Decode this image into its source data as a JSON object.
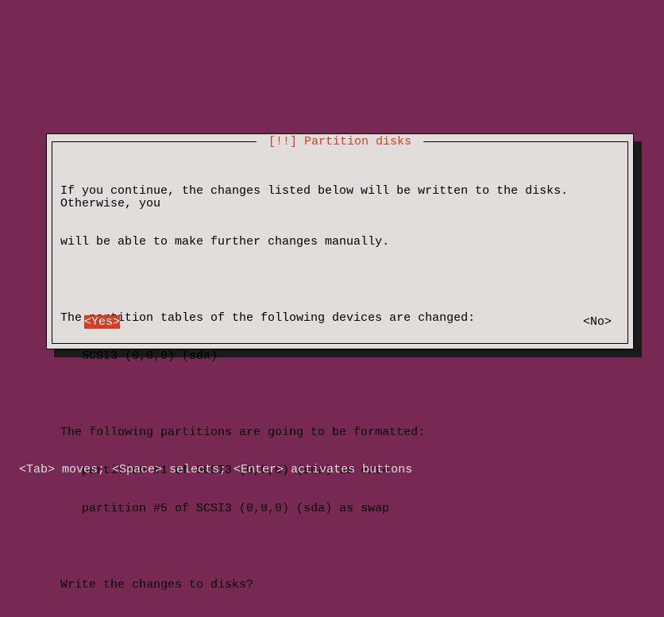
{
  "dialog": {
    "title": " [!!] Partition disks ",
    "lines": [
      "If you continue, the changes listed below will be written to the disks. Otherwise, you",
      "will be able to make further changes manually.",
      "",
      "The partition tables of the following devices are changed:",
      "   SCSI3 (0,0,0) (sda)",
      "",
      "The following partitions are going to be formatted:",
      "   partition #1 of SCSI3 (0,0,0) (sda) as ext4",
      "   partition #5 of SCSI3 (0,0,0) (sda) as swap",
      "",
      "Write the changes to disks?"
    ],
    "yes_label": "<Yes>",
    "no_label": "<No>"
  },
  "status_bar": "<Tab> moves; <Space> selects; <Enter> activates buttons"
}
